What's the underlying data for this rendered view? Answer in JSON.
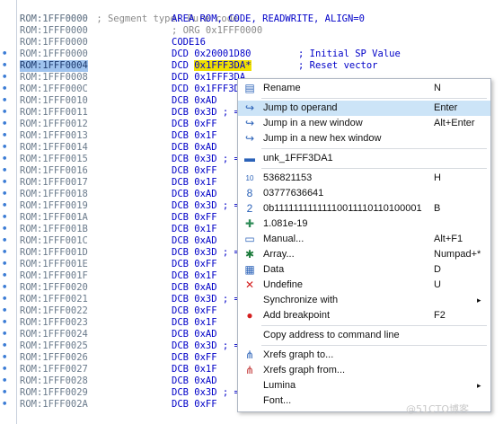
{
  "listing": {
    "header": {
      "addr": "ROM:1FFF0000",
      "comment": " ; Segment type: Pure code"
    },
    "lines": [
      {
        "addr": "ROM:1FFF0000",
        "ins": "AREA ROM, CODE, READWRITE, ALIGN=0"
      },
      {
        "addr": "ROM:1FFF0000",
        "ins": "; ORG 0x1FFF0000",
        "gray": true
      },
      {
        "addr": "ROM:1FFF0000",
        "ins": "CODE16"
      },
      {
        "addr": "ROM:1FFF0000",
        "ins": "DCD 0x20001D80",
        "right": "; Initial SP Value",
        "dot": true
      },
      {
        "addr": "ROM:1FFF0004",
        "ins": "DCD ",
        "sel": "0x1FFF3DA*",
        "right": "; Reset vector",
        "dot": true,
        "hl": true
      },
      {
        "addr": "ROM:1FFF0008",
        "ins": "DCD 0x1FFF3DA",
        "dot": true
      },
      {
        "addr": "ROM:1FFF000C",
        "ins": "DCD 0x1FFF3DA",
        "dot": true
      },
      {
        "addr": "ROM:1FFF0010",
        "ins": "DCB 0xAD",
        "dot": true
      },
      {
        "addr": "ROM:1FFF0011",
        "ins": "DCB 0x3D ; =",
        "dot": true
      },
      {
        "addr": "ROM:1FFF0012",
        "ins": "DCB 0xFF",
        "dot": true
      },
      {
        "addr": "ROM:1FFF0013",
        "ins": "DCB 0x1F",
        "dot": true
      },
      {
        "addr": "ROM:1FFF0014",
        "ins": "DCB 0xAD",
        "dot": true
      },
      {
        "addr": "ROM:1FFF0015",
        "ins": "DCB 0x3D ; =",
        "dot": true
      },
      {
        "addr": "ROM:1FFF0016",
        "ins": "DCB 0xFF",
        "dot": true
      },
      {
        "addr": "ROM:1FFF0017",
        "ins": "DCB 0x1F",
        "dot": true
      },
      {
        "addr": "ROM:1FFF0018",
        "ins": "DCB 0xAD",
        "dot": true
      },
      {
        "addr": "ROM:1FFF0019",
        "ins": "DCB 0x3D ; =",
        "dot": true
      },
      {
        "addr": "ROM:1FFF001A",
        "ins": "DCB 0xFF",
        "dot": true
      },
      {
        "addr": "ROM:1FFF001B",
        "ins": "DCB 0x1F",
        "dot": true
      },
      {
        "addr": "ROM:1FFF001C",
        "ins": "DCB 0xAD",
        "dot": true
      },
      {
        "addr": "ROM:1FFF001D",
        "ins": "DCB 0x3D ; =",
        "dot": true
      },
      {
        "addr": "ROM:1FFF001E",
        "ins": "DCB 0xFF",
        "dot": true
      },
      {
        "addr": "ROM:1FFF001F",
        "ins": "DCB 0x1F",
        "dot": true
      },
      {
        "addr": "ROM:1FFF0020",
        "ins": "DCB 0xAD",
        "dot": true
      },
      {
        "addr": "ROM:1FFF0021",
        "ins": "DCB 0x3D ; =",
        "dot": true
      },
      {
        "addr": "ROM:1FFF0022",
        "ins": "DCB 0xFF",
        "dot": true
      },
      {
        "addr": "ROM:1FFF0023",
        "ins": "DCB 0x1F",
        "dot": true
      },
      {
        "addr": "ROM:1FFF0024",
        "ins": "DCB 0xAD",
        "dot": true
      },
      {
        "addr": "ROM:1FFF0025",
        "ins": "DCB 0x3D ; =",
        "dot": true
      },
      {
        "addr": "ROM:1FFF0026",
        "ins": "DCB 0xFF",
        "dot": true
      },
      {
        "addr": "ROM:1FFF0027",
        "ins": "DCB 0x1F",
        "dot": true
      },
      {
        "addr": "ROM:1FFF0028",
        "ins": "DCB 0xAD",
        "dot": true
      },
      {
        "addr": "ROM:1FFF0029",
        "ins": "DCB 0x3D ; =",
        "dot": true
      },
      {
        "addr": "ROM:1FFF002A",
        "ins": "DCB 0xFF",
        "dot": true
      }
    ]
  },
  "menu": {
    "items": [
      {
        "type": "item",
        "name": "menu-rename",
        "label": "Rename",
        "shortcut": "N",
        "icon": "rename-icon",
        "glyph": "▤",
        "color": "#2b62b8"
      },
      {
        "type": "sep"
      },
      {
        "type": "item",
        "name": "menu-jump-to-operand",
        "label": "Jump to operand",
        "shortcut": "Enter",
        "icon": "jump-arrow-icon",
        "glyph": "↪",
        "color": "#2b62b8",
        "active": true
      },
      {
        "type": "item",
        "name": "menu-jump-new-window",
        "label": "Jump in a new window",
        "shortcut": "Alt+Enter",
        "icon": "jump-arrow-icon",
        "glyph": "↪",
        "color": "#2b62b8"
      },
      {
        "type": "item",
        "name": "menu-jump-new-hex-window",
        "label": "Jump in a new hex window",
        "shortcut": "",
        "icon": "jump-arrow-icon",
        "glyph": "↪",
        "color": "#2b62b8"
      },
      {
        "type": "sep"
      },
      {
        "type": "item",
        "name": "menu-unk-label",
        "label": "unk_1FFF3DA1",
        "shortcut": "",
        "icon": "label-icon",
        "glyph": "▬",
        "color": "#2b62b8"
      },
      {
        "type": "sep"
      },
      {
        "type": "item",
        "name": "menu-decimal",
        "label": "536821153",
        "shortcut": "H",
        "icon": "decimal-icon",
        "glyph": "10",
        "color": "#2b62b8"
      },
      {
        "type": "item",
        "name": "menu-octal",
        "label": "03777636641",
        "shortcut": "",
        "icon": "octal-icon",
        "glyph": "8",
        "color": "#2b62b8"
      },
      {
        "type": "item",
        "name": "menu-binary",
        "label": "0b11111111111110011110110100001",
        "shortcut": "B",
        "icon": "binary-icon",
        "glyph": "2",
        "color": "#2b62b8"
      },
      {
        "type": "item",
        "name": "menu-float",
        "label": "1.081e-19",
        "shortcut": "",
        "icon": "float-icon",
        "glyph": "✚",
        "color": "#2e8b57"
      },
      {
        "type": "item",
        "name": "menu-manual",
        "label": "Manual...",
        "shortcut": "Alt+F1",
        "icon": "manual-icon",
        "glyph": "▭",
        "color": "#2b62b8"
      },
      {
        "type": "item",
        "name": "menu-array",
        "label": "Array...",
        "shortcut": "Numpad+*",
        "icon": "array-icon",
        "glyph": "✱",
        "color": "#1a7a3a"
      },
      {
        "type": "item",
        "name": "menu-data",
        "label": "Data",
        "shortcut": "D",
        "icon": "data-icon",
        "glyph": "▦",
        "color": "#2b62b8"
      },
      {
        "type": "item",
        "name": "menu-undefine",
        "label": "Undefine",
        "shortcut": "U",
        "icon": "undefine-x-icon",
        "glyph": "✕",
        "color": "#d42020"
      },
      {
        "type": "item",
        "name": "menu-synchronize-with",
        "label": "Synchronize with",
        "shortcut": "",
        "icon": "",
        "glyph": "",
        "color": "#000",
        "submenu": true
      },
      {
        "type": "item",
        "name": "menu-add-breakpoint",
        "label": "Add breakpoint",
        "shortcut": "F2",
        "icon": "breakpoint-icon",
        "glyph": "●",
        "color": "#d42020"
      },
      {
        "type": "sep"
      },
      {
        "type": "item",
        "name": "menu-copy-address",
        "label": "Copy address to command line",
        "shortcut": "",
        "icon": "",
        "glyph": "",
        "color": "#000"
      },
      {
        "type": "sep"
      },
      {
        "type": "item",
        "name": "menu-xrefs-to",
        "label": "Xrefs graph to...",
        "shortcut": "",
        "icon": "xrefs-graph-icon",
        "glyph": "⋔",
        "color": "#2b62b8"
      },
      {
        "type": "item",
        "name": "menu-xrefs-from",
        "label": "Xrefs graph from...",
        "shortcut": "",
        "icon": "xrefs-graph-icon",
        "glyph": "⋔",
        "color": "#c03030"
      },
      {
        "type": "item",
        "name": "menu-lumina",
        "label": "Lumina",
        "shortcut": "",
        "icon": "",
        "glyph": "",
        "color": "#000",
        "submenu": true
      },
      {
        "type": "item",
        "name": "menu-font",
        "label": "Font...",
        "shortcut": "",
        "icon": "",
        "glyph": "",
        "color": "#000"
      }
    ],
    "submenu_arrow": "▸"
  },
  "watermark": "@51CTO博客"
}
